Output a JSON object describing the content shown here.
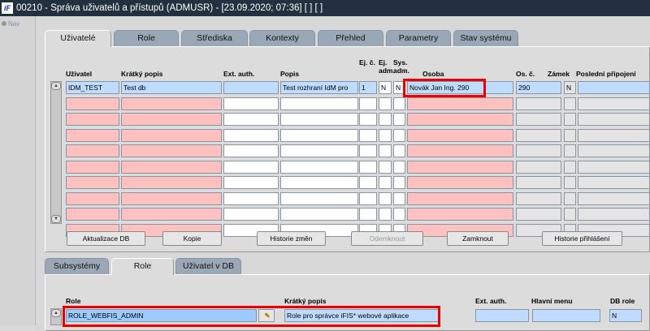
{
  "window": {
    "title": "00210 - Správa uživatelů a přístupů (ADMUSR) - [23.09.2020; 07:36]  [ ]  [ ]",
    "logo": "iF"
  },
  "nav": {
    "label": "Nav"
  },
  "top_tabs": [
    "Uživatelé",
    "Role",
    "Střediska",
    "Kontexty",
    "Přehled",
    "Parametry",
    "Stav systému"
  ],
  "top_tabs_active": 0,
  "users_table": {
    "headers": [
      "Uživatel",
      "Krátký popis",
      "Ext. auth.",
      "Popis",
      "Ej. č.",
      "Ej. adm.",
      "Sys. adm.",
      "Osoba",
      "Os. č.",
      "Zámek",
      "Poslední připojení"
    ],
    "rows": [
      [
        "IDM_TEST",
        "Test db",
        "",
        "Test rozhraní IdM pro",
        "1",
        "N",
        "N",
        "Novák Jan Ing. 290",
        "290",
        "N",
        ""
      ]
    ],
    "empty_rows": 9
  },
  "buttons": [
    {
      "label": "Aktualizace DB",
      "enabled": true
    },
    {
      "label": "Kopie",
      "enabled": true
    },
    {
      "label": "Historie změn",
      "enabled": true
    },
    {
      "label": "Odemknout",
      "enabled": false
    },
    {
      "label": "Zamknout",
      "enabled": true
    },
    {
      "label": "Historie přihlášení",
      "enabled": true
    }
  ],
  "bottom_tabs": [
    "Subsystémy",
    "Role",
    "Uživatel v DB"
  ],
  "bottom_tabs_active": 1,
  "roles_table": {
    "headers": [
      "Role",
      "Krátký popis",
      "Ext. auth.",
      "Hlavní menu",
      "DB role"
    ],
    "rows": [
      [
        "ROLE_WEBFIS_ADMIN",
        "Role pro správce iFIS* webové aplikace",
        "",
        "",
        "N"
      ]
    ]
  },
  "colors": {
    "highlight": "#ee0000",
    "selected_row": "#bfdcff",
    "required": "#ffc0c0",
    "title_bar": "#23303f"
  }
}
